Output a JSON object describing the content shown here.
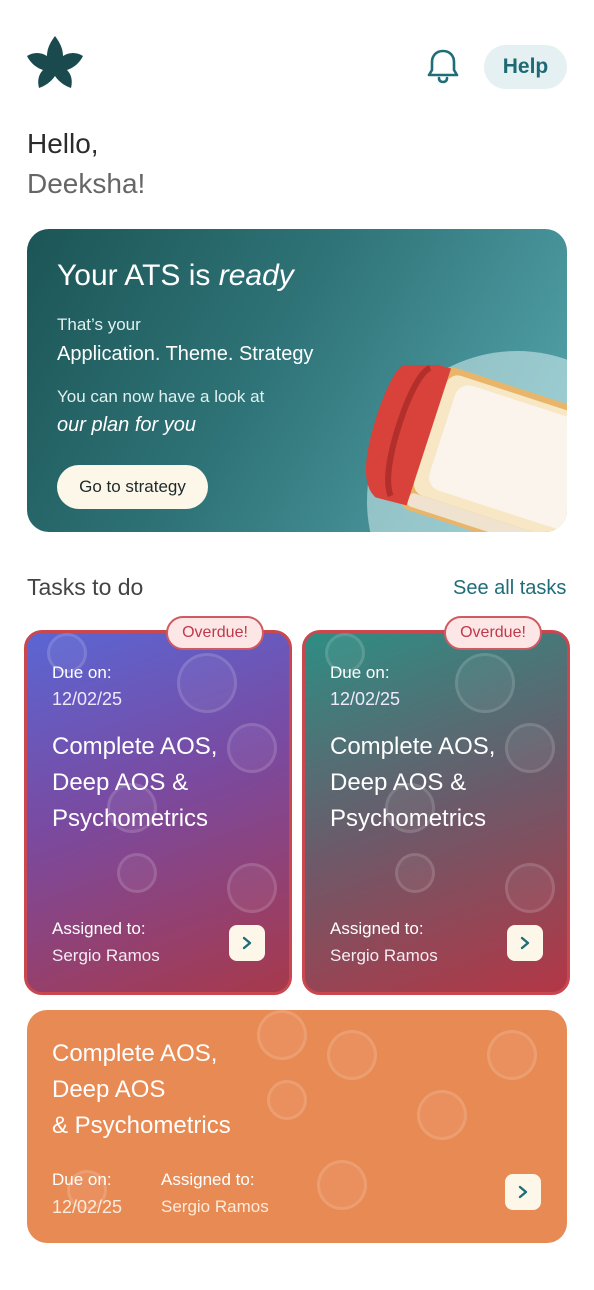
{
  "header": {
    "help_label": "Help"
  },
  "greeting": {
    "line1": "Hello,",
    "line2": "Deeksha!"
  },
  "hero": {
    "title_prefix": "Your ATS is ",
    "title_emphasis": "ready",
    "line1": "That’s your",
    "line2": "Application. Theme. Strategy",
    "line3": "You can now have a look at",
    "line4": "our plan for you",
    "button_label": "Go to strategy"
  },
  "tasks": {
    "section_title": "Tasks to do",
    "see_all_label": "See all tasks",
    "cards": [
      {
        "badge": "Overdue!",
        "due_label": "Due on:",
        "due_date": "12/02/25",
        "title": "Complete AOS, Deep AOS & Psychometrics",
        "assign_label": "Assigned to:",
        "assignee": "Sergio Ramos"
      },
      {
        "badge": "Overdue!",
        "due_label": "Due on:",
        "due_date": "12/02/25",
        "title": "Complete AOS, Deep AOS & Psychometrics",
        "assign_label": "Assigned to:",
        "assignee": "Sergio Ramos"
      }
    ],
    "wide_card": {
      "title_line1": "Complete AOS,",
      "title_line2": "Deep AOS",
      "title_line3": "& Psychometrics",
      "due_label": "Due on:",
      "due_date": "12/02/25",
      "assign_label": "Assigned to:",
      "assignee": "Sergio Ramos"
    }
  },
  "colors": {
    "brand_teal": "#1d4f52",
    "accent_teal": "#1f6d78",
    "overdue_red": "#c9474f",
    "orange_card": "#e88a54"
  },
  "icons": [
    "leaf-logo-icon",
    "bell-icon",
    "chevron-right-icon",
    "book-illustration"
  ]
}
